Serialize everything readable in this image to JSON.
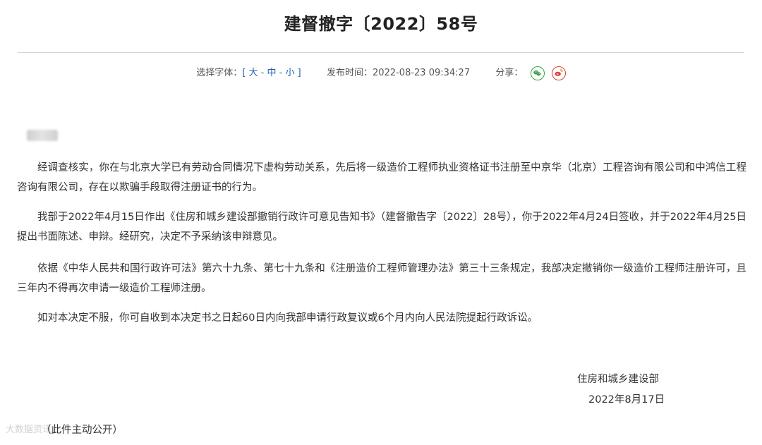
{
  "title": "建督撤字〔2022〕58号",
  "meta": {
    "font_label": "选择字体：",
    "bracket_open": "[ ",
    "size_large": "大",
    "size_medium": "中",
    "size_small": "小",
    "dash": " - ",
    "bracket_close": " ]",
    "publish_label": "发布时间：",
    "publish_time": "2022-08-23 09:34:27",
    "share_label": "分享："
  },
  "icons": {
    "wechat": "wechat-icon",
    "weibo": "weibo-icon",
    "wechat_color": "#3aa046",
    "weibo_color": "#d8403a"
  },
  "body": {
    "p1": "经调查核实，你在与北京大学已有劳动合同情况下虚构劳动关系，先后将一级造价工程师执业资格证书注册至中京华（北京）工程咨询有限公司和中鸿信工程咨询有限公司，存在以欺骗手段取得注册证书的行为。",
    "p2": "我部于2022年4月15日作出《住房和城乡建设部撤销行政许可意见告知书》（建督撤告字〔2022〕28号），你于2022年4月24日签收，并于2022年4月25日提出书面陈述、申辩。经研究，决定不予采纳该申辩意见。",
    "p3": "依据《中华人民共和国行政许可法》第六十九条、第七十九条和《注册造价工程师管理办法》第三十三条规定，我部决定撤销你一级造价工程师注册许可，且三年内不得再次申请一级造价工程师注册。",
    "p4": "如对本决定不服，你可自收到本决定书之日起60日内向我部申请行政复议或6个月内向人民法院提起行政诉讼。"
  },
  "signature": {
    "org": "住房和城乡建设部",
    "date": "2022年8月17日"
  },
  "note": "（此件主动公开）",
  "watermark": "大数据资讯"
}
